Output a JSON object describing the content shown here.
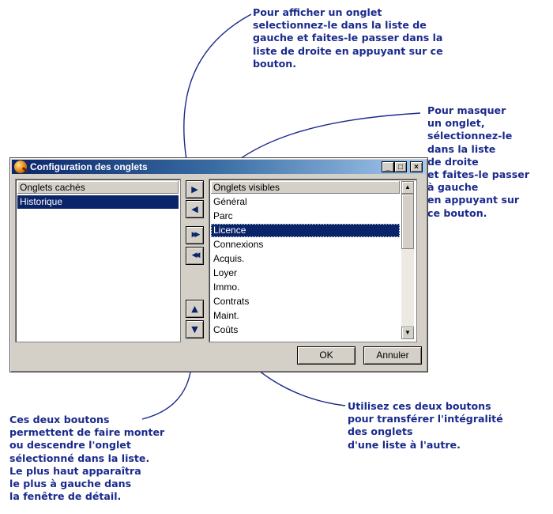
{
  "callouts": {
    "top": "Pour afficher un onglet\nselectionnez-le dans la liste de\ngauche et faites-le passer dans la\nliste de droite en appuyant sur ce\nbouton.",
    "right": "Pour masquer\nun onglet,\nsélectionnez-le\ndans la liste\nde droite\net faites-le passer\nà gauche\nen appuyant sur\nce bouton.",
    "bottom_left": "Ces deux boutons\npermettent de faire monter\nou descendre l'onglet\nsélectionné dans la liste.\nLe plus haut apparaîtra\nle plus à gauche dans\nla fenêtre de détail.",
    "bottom_right": "Utilisez ces deux boutons\npour transférer l'intégralité\ndes onglets\nd'une liste à l'autre."
  },
  "window": {
    "title": "Configuration des onglets",
    "controls": {
      "minimize": "_",
      "maximize": "□",
      "close": "×"
    },
    "title_icon": "app-icon"
  },
  "hidden_tabs": {
    "header": "Onglets cachés",
    "items": [
      "Historique"
    ],
    "selected": "Historique"
  },
  "visible_tabs": {
    "header": "Onglets visibles",
    "items": [
      "Général",
      "Parc",
      "Licence",
      "Connexions",
      "Acquis.",
      "Loyer",
      "Immo.",
      "Contrats",
      "Maint.",
      "Coûts"
    ],
    "selected": "Licence"
  },
  "move_buttons": {
    "show": "▶",
    "hide": "◀",
    "show_all": "▶▶",
    "hide_all": "◀◀",
    "move_up": "▲",
    "move_down": "▼"
  },
  "actions": {
    "ok": "OK",
    "cancel": "Annuler"
  },
  "colors": {
    "callout_text": "#1a2a8c",
    "arrow": "#1a2a8c",
    "selection": "#0a246a",
    "face": "#d4d0c8"
  }
}
